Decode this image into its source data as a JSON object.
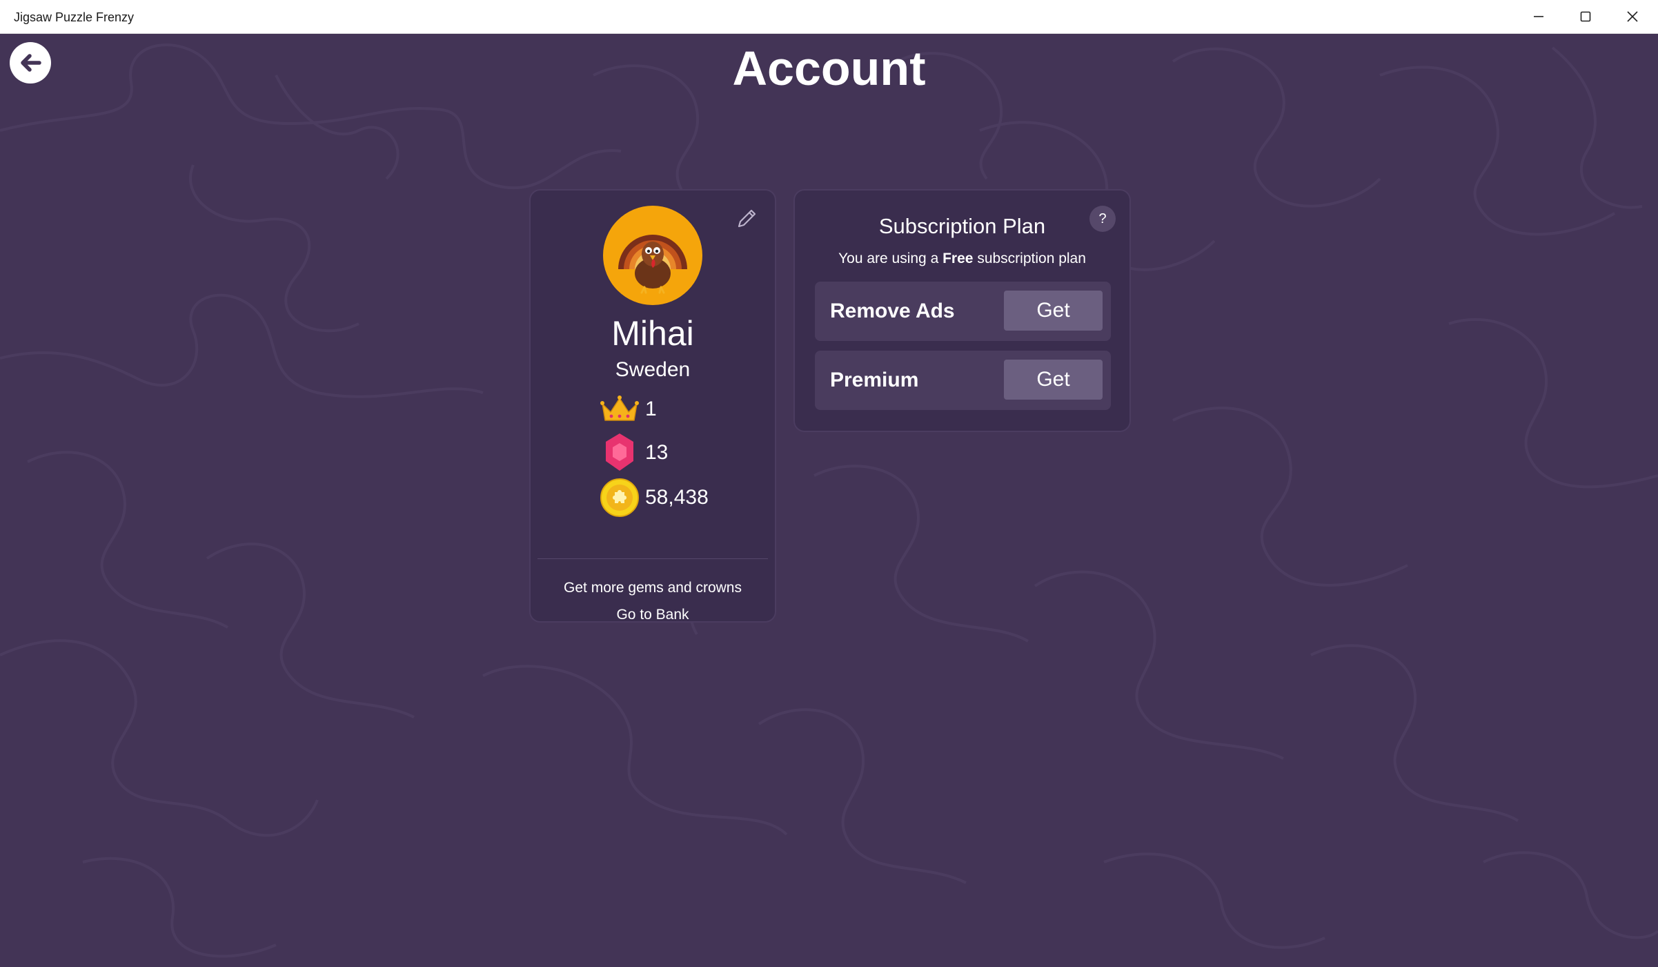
{
  "window": {
    "title": "Jigsaw Puzzle Frenzy",
    "minimize_icon": "minimize-icon",
    "maximize_icon": "maximize-icon",
    "close_icon": "close-icon"
  },
  "header": {
    "title": "Account",
    "back_icon": "arrow-left-icon"
  },
  "profile": {
    "name": "Mihai",
    "country": "Sweden",
    "avatar_icon": "turkey-avatar",
    "edit_icon": "pencil-icon",
    "crowns": "1",
    "gems": "13",
    "coins": "58,438",
    "bank_line1": "Get more gems and crowns",
    "bank_line2": "Go to Bank"
  },
  "subscription": {
    "title": "Subscription Plan",
    "help_label": "?",
    "desc_prefix": "You are using a",
    "desc_plan": "Free",
    "desc_suffix": "subscription plan",
    "plans": [
      {
        "label": "Remove Ads",
        "button": "Get"
      },
      {
        "label": "Premium",
        "button": "Get"
      }
    ]
  },
  "colors": {
    "background": "#433456",
    "card": "#3a2d4e",
    "row": "#4a3c5e",
    "button": "#6b5f80",
    "avatar_bg": "#f5a50b",
    "gem": "#e8336f",
    "coin": "#f7d31a"
  }
}
